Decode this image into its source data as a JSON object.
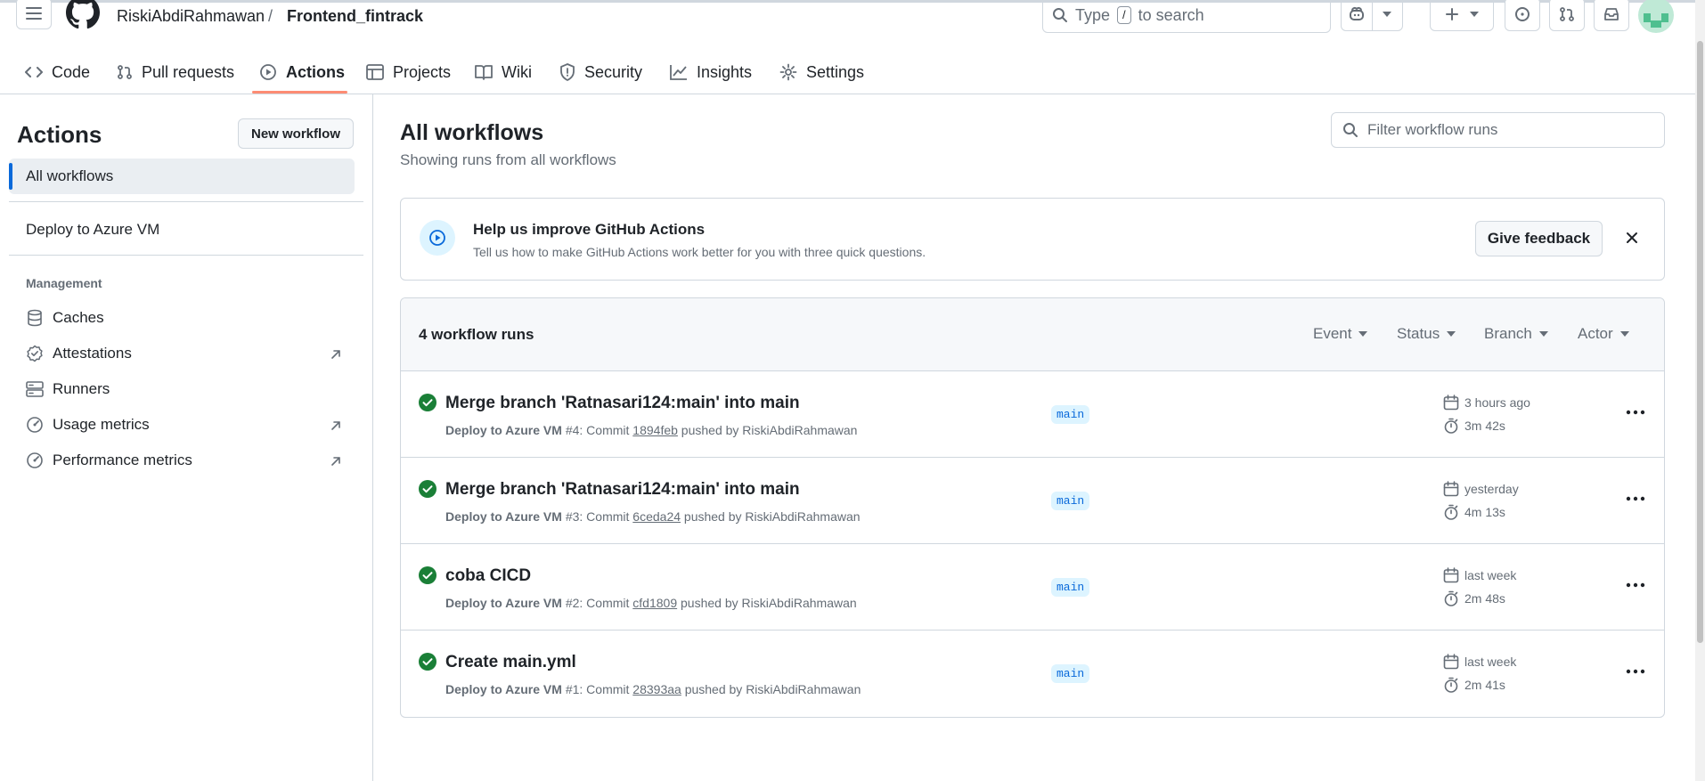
{
  "header": {
    "owner": "RiskiAbdiRahmawan",
    "separator": "/",
    "repo": "Frontend_fintrack",
    "search": {
      "prefix": "Type",
      "key": "/",
      "suffix": "to search"
    }
  },
  "tabs": [
    {
      "label": "Code",
      "icon": "code-icon"
    },
    {
      "label": "Pull requests",
      "icon": "git-pull-request-icon"
    },
    {
      "label": "Actions",
      "icon": "play-icon",
      "active": true
    },
    {
      "label": "Projects",
      "icon": "table-icon"
    },
    {
      "label": "Wiki",
      "icon": "book-icon"
    },
    {
      "label": "Security",
      "icon": "shield-icon"
    },
    {
      "label": "Insights",
      "icon": "graph-icon"
    },
    {
      "label": "Settings",
      "icon": "gear-icon"
    }
  ],
  "sidebar": {
    "title": "Actions",
    "new_workflow": "New workflow",
    "all_workflows": "All workflows",
    "workflows": [
      "Deploy to Azure VM"
    ],
    "management_label": "Management",
    "management": [
      {
        "label": "Caches",
        "icon": "database-icon",
        "external": false
      },
      {
        "label": "Attestations",
        "icon": "verified-icon",
        "external": true
      },
      {
        "label": "Runners",
        "icon": "server-icon",
        "external": false
      },
      {
        "label": "Usage metrics",
        "icon": "meter-icon",
        "external": true
      },
      {
        "label": "Performance metrics",
        "icon": "meter-icon",
        "external": true
      }
    ]
  },
  "main": {
    "title": "All workflows",
    "subtitle": "Showing runs from all workflows",
    "filter_placeholder": "Filter workflow runs"
  },
  "banner": {
    "title": "Help us improve GitHub Actions",
    "text": "Tell us how to make GitHub Actions work better for you with three quick questions.",
    "button": "Give feedback"
  },
  "runs": {
    "count": "4 workflow runs",
    "filters": [
      "Event",
      "Status",
      "Branch",
      "Actor"
    ],
    "items": [
      {
        "title": "Merge branch 'Ratnasari124:main' into main",
        "workflow": "Deploy to Azure VM",
        "run": "#4",
        "commit_label": ": Commit",
        "sha": "1894feb",
        "pushed_by": "pushed by RiskiAbdiRahmawan",
        "branch": "main",
        "when": "3 hours ago",
        "duration": "3m 42s"
      },
      {
        "title": "Merge branch 'Ratnasari124:main' into main",
        "workflow": "Deploy to Azure VM",
        "run": "#3",
        "commit_label": ": Commit",
        "sha": "6ceda24",
        "pushed_by": "pushed by RiskiAbdiRahmawan",
        "branch": "main",
        "when": "yesterday",
        "duration": "4m 13s"
      },
      {
        "title": "coba CICD",
        "workflow": "Deploy to Azure VM",
        "run": "#2",
        "commit_label": ": Commit",
        "sha": "cfd1809",
        "pushed_by": "pushed by RiskiAbdiRahmawan",
        "branch": "main",
        "when": "last week",
        "duration": "2m 48s"
      },
      {
        "title": "Create main.yml",
        "workflow": "Deploy to Azure VM",
        "run": "#1",
        "commit_label": ": Commit",
        "sha": "28393aa",
        "pushed_by": "pushed by RiskiAbdiRahmawan",
        "branch": "main",
        "when": "last week",
        "duration": "2m 41s"
      }
    ]
  },
  "colors": {
    "accent": "#0969da",
    "success": "#1a7f37",
    "tab_underline": "#fd8c73",
    "border": "#d0d7de"
  }
}
